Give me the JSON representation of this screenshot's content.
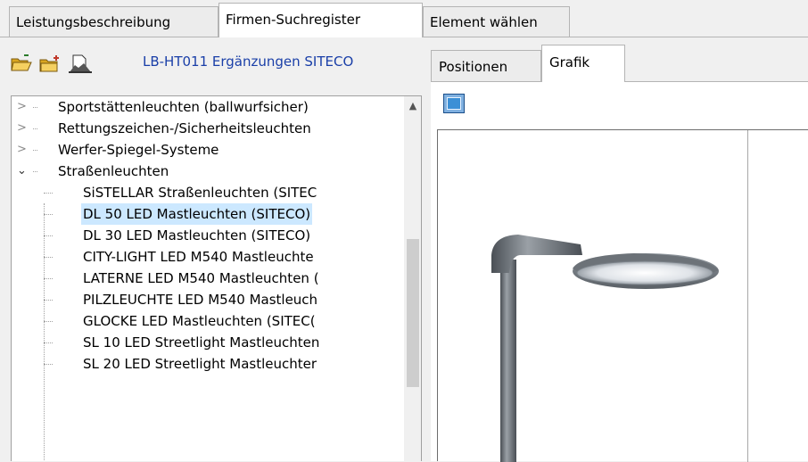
{
  "top_tabs": [
    {
      "label": "Leistungsbeschreibung",
      "active": false
    },
    {
      "label": "Firmen-Suchregister",
      "active": true
    },
    {
      "label": "Element wählen",
      "active": false
    }
  ],
  "toolbar": {
    "icons": [
      "open-folder-icon",
      "new-folder-icon",
      "pdf-doc-icon"
    ],
    "title": "LB-HT011 Ergänzungen SITECO"
  },
  "tree": {
    "items": [
      {
        "label": "Sportstättenleuchten (ballwurfsicher)",
        "level": 0,
        "expanded": false
      },
      {
        "label": "Rettungszeichen-/Sicherheitsleuchten",
        "level": 0,
        "expanded": false
      },
      {
        "label": "Werfer-Spiegel-Systeme",
        "level": 0,
        "expanded": false
      },
      {
        "label": "Straßenleuchten",
        "level": 0,
        "expanded": true
      },
      {
        "label": "SiSTELLAR Straßenleuchten (SITEC",
        "level": 1
      },
      {
        "label": "DL 50 LED Mastleuchten (SITECO)",
        "level": 1,
        "selected": true
      },
      {
        "label": "DL 30 LED Mastleuchten (SITECO)",
        "level": 1
      },
      {
        "label": "CITY-LIGHT LED M540 Mastleuchte",
        "level": 1
      },
      {
        "label": "LATERNE LED M540 Mastleuchten (",
        "level": 1
      },
      {
        "label": "PILZLEUCHTE LED M540 Mastleuch",
        "level": 1
      },
      {
        "label": "GLOCKE LED Mastleuchten (SITEC(",
        "level": 1
      },
      {
        "label": "SL 10 LED Streetlight Mastleuchten",
        "level": 1
      },
      {
        "label": "SL 20 LED Streetlight Mastleuchter",
        "level": 1
      }
    ]
  },
  "right_tabs": [
    {
      "label": "Positionen",
      "active": false
    },
    {
      "label": "Grafik",
      "active": true
    }
  ],
  "colors": {
    "selection": "#cce8ff",
    "title_link": "#1a3fa8"
  }
}
